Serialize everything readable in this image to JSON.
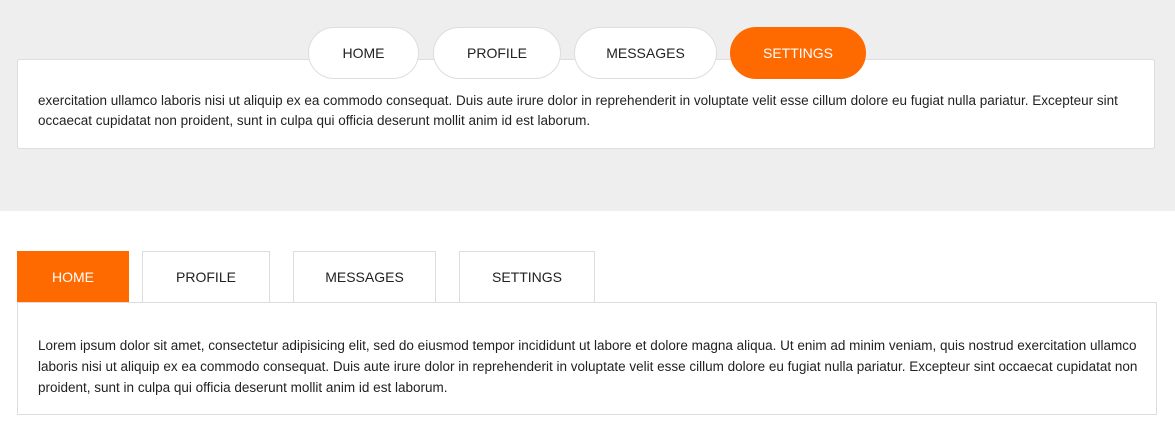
{
  "top_tabs": {
    "items": [
      {
        "label": "HOME"
      },
      {
        "label": "PROFILE"
      },
      {
        "label": "MESSAGES"
      },
      {
        "label": "SETTINGS"
      }
    ],
    "active_label": "SETTINGS",
    "content": "exercitation ullamco laboris nisi ut aliquip ex ea commodo consequat. Duis aute irure dolor in reprehenderit in voluptate velit esse cillum dolore eu fugiat nulla pariatur. Excepteur sint occaecat cupidatat non proident, sunt in culpa qui officia deserunt mollit anim id est laborum."
  },
  "bottom_tabs": {
    "items": [
      {
        "label": "HOME"
      },
      {
        "label": "PROFILE"
      },
      {
        "label": "MESSAGES"
      },
      {
        "label": "SETTINGS"
      }
    ],
    "active_label": "HOME",
    "content": "Lorem ipsum dolor sit amet, consectetur adipisicing elit, sed do eiusmod tempor incididunt ut labore et dolore magna aliqua. Ut enim ad minim veniam, quis nostrud exercitation ullamco laboris nisi ut aliquip ex ea commodo consequat. Duis aute irure dolor in reprehenderit in voluptate velit esse cillum dolore eu fugiat nulla pariatur. Excepteur sint occaecat cupidatat non proident, sunt in culpa qui officia deserunt mollit anim id est laborum."
  },
  "colors": {
    "accent": "#ff6a00",
    "top_background": "#eeeeee",
    "border": "#dddddd",
    "text": "#222222"
  }
}
